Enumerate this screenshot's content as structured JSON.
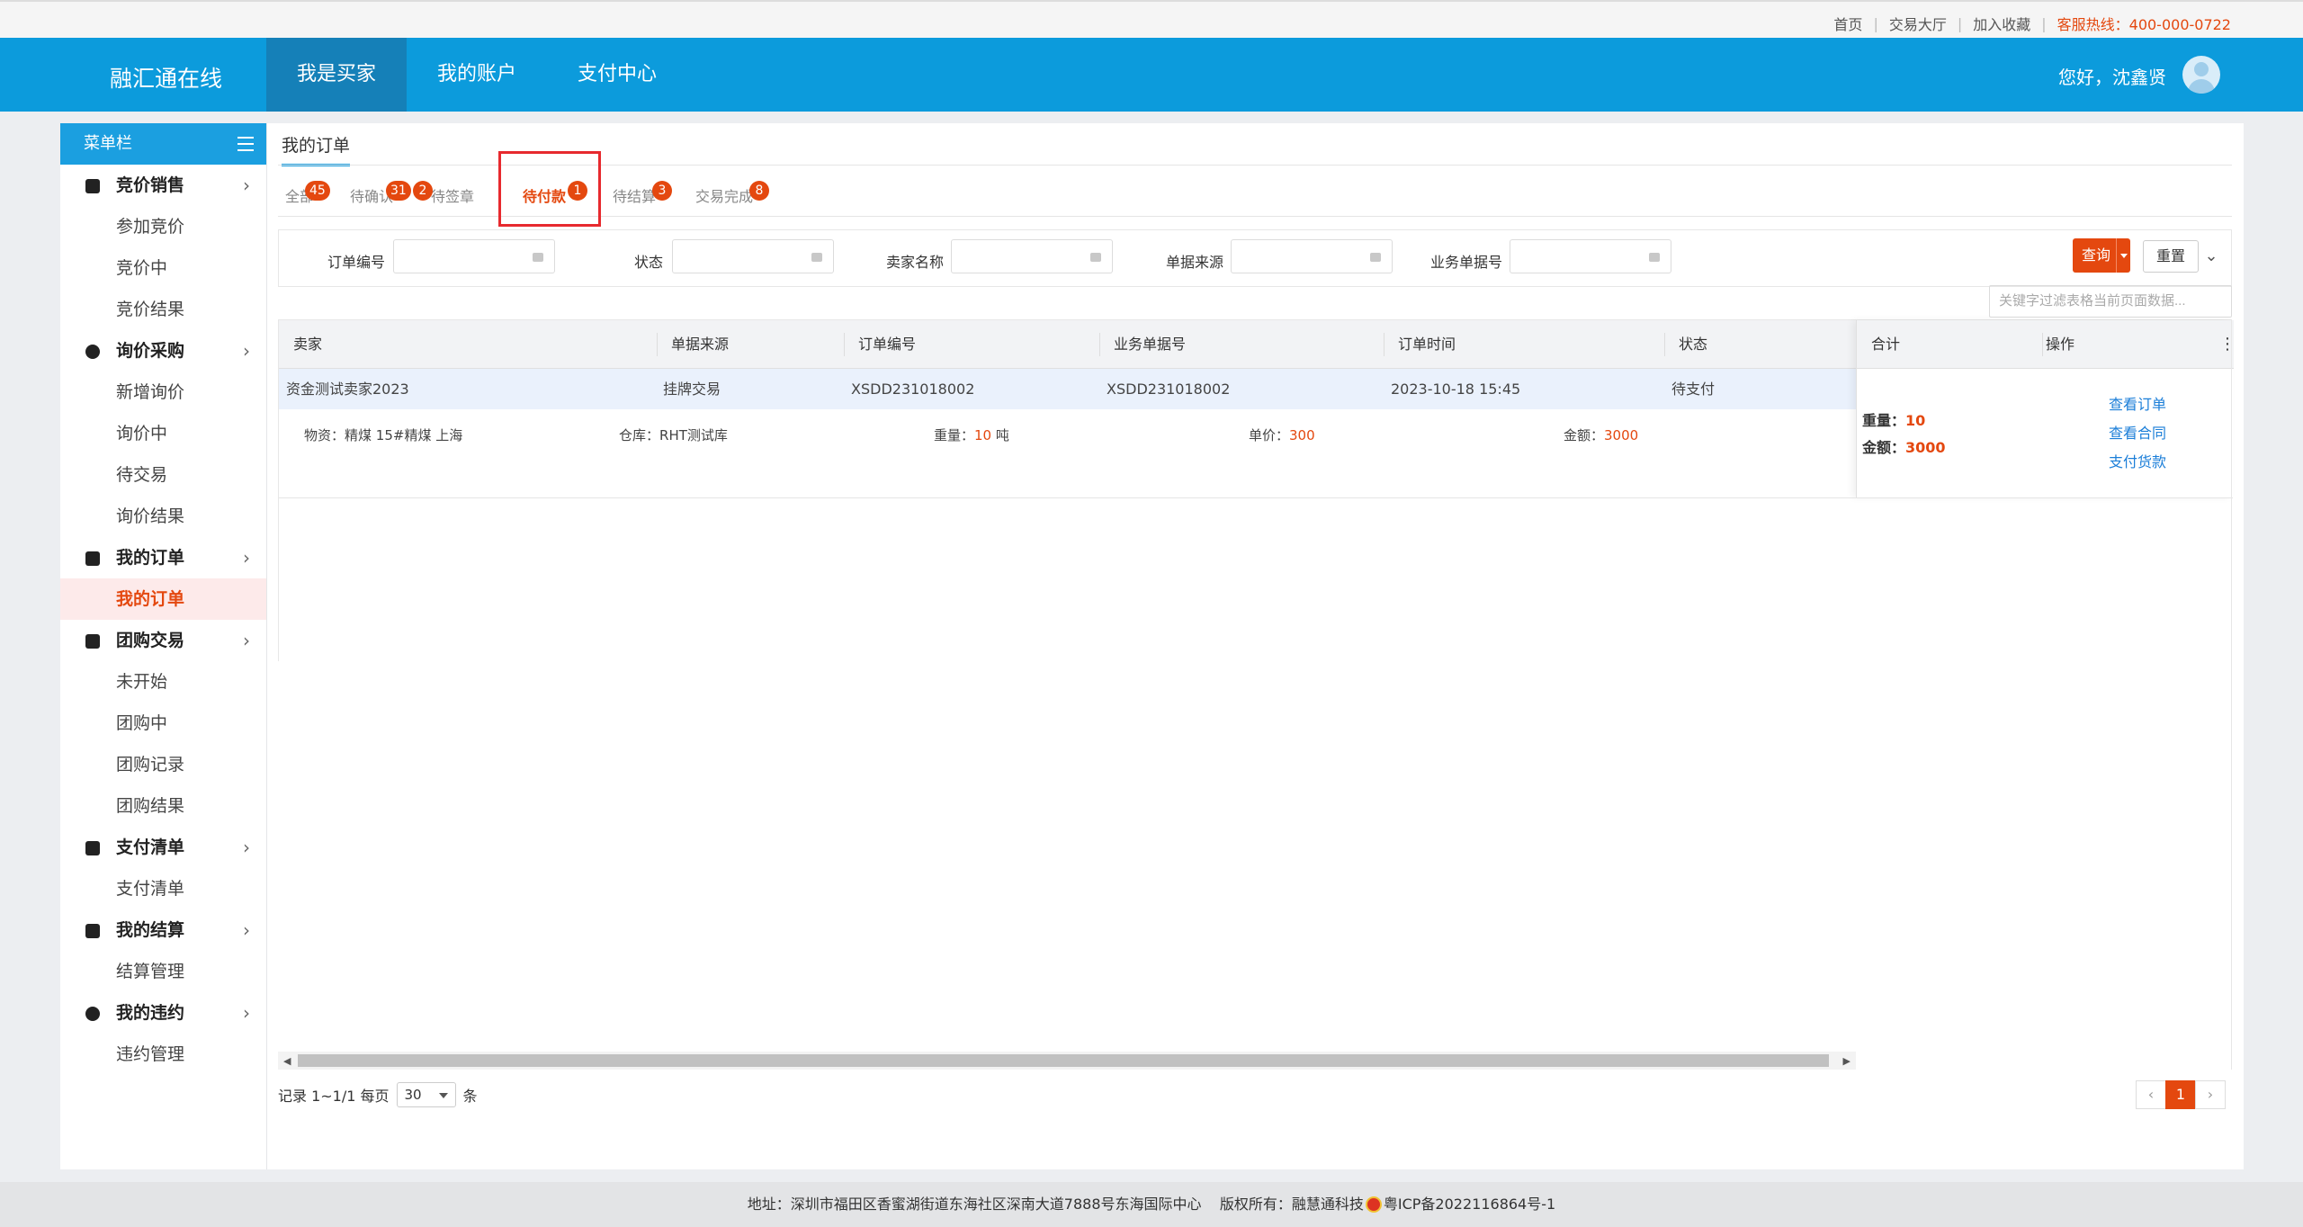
{
  "top_links": {
    "home": "首页",
    "trade_hall": "交易大厅",
    "favorite": "加入收藏",
    "hotline": "客服热线：400-000-0722"
  },
  "header": {
    "logo": "融汇通在线",
    "nav": [
      "我是买家",
      "我的账户",
      "支付中心"
    ],
    "greeting": "您好，沈鑫贤"
  },
  "sidebar": {
    "title": "菜单栏",
    "groups": [
      {
        "label": "竞价销售",
        "icon": "gavel-icon",
        "items": [
          "参加竞价",
          "竞价中",
          "竞价结果"
        ]
      },
      {
        "label": "询价采购",
        "icon": "search-circle-icon",
        "items": [
          "新增询价",
          "询价中",
          "待交易",
          "询价结果"
        ]
      },
      {
        "label": "我的订单",
        "icon": "document-icon",
        "items": [
          "我的订单"
        ]
      },
      {
        "label": "团购交易",
        "icon": "shop-icon",
        "items": [
          "未开始",
          "团购中",
          "团购记录",
          "团购结果"
        ]
      },
      {
        "label": "支付清单",
        "icon": "payment-icon",
        "items": [
          "支付清单"
        ]
      },
      {
        "label": "我的结算",
        "icon": "calculator-icon",
        "items": [
          "结算管理"
        ]
      },
      {
        "label": "我的违约",
        "icon": "alert-icon",
        "items": [
          "违约管理"
        ]
      }
    ]
  },
  "page": {
    "title": "我的订单"
  },
  "tabs": [
    {
      "label": "全部",
      "badge": "45"
    },
    {
      "label": "待确认",
      "badge": "31"
    },
    {
      "label": "待签章",
      "badge": "2"
    },
    {
      "label": "待付款",
      "badge": "1"
    },
    {
      "label": "待结算",
      "badge": "3"
    },
    {
      "label": "交易完成",
      "badge": "8"
    }
  ],
  "filters": {
    "order_no": "订单编号",
    "status": "状态",
    "seller": "卖家名称",
    "source": "单据来源",
    "biz_no": "业务单据号",
    "query": "查询",
    "reset": "重置",
    "search_placeholder": "关键字过滤表格当前页面数据..."
  },
  "table": {
    "headers": [
      "卖家",
      "单据来源",
      "订单编号",
      "业务单据号",
      "订单时间",
      "状态",
      "合计",
      "操作"
    ],
    "row": {
      "seller": "资金测试卖家2023",
      "source": "挂牌交易",
      "order_no": "XSDD231018002",
      "biz_no": "XSDD231018002",
      "time": "2023-10-18 15:45",
      "status": "待支付"
    },
    "detail": {
      "material_label": "物资：",
      "material": "精煤 15#精煤 上海",
      "warehouse_label": "仓库：",
      "warehouse": "RHT测试库",
      "weight_label": "重量：",
      "weight_value": "10",
      "weight_unit": "吨",
      "price_label": "单价：",
      "price": "300",
      "amount_label": "金额：",
      "amount": "3000"
    },
    "summary": {
      "weight_label": "重量：",
      "weight": "10",
      "amount_label": "金额：",
      "amount": "3000"
    },
    "actions": [
      "查看订单",
      "查看合同",
      "支付货款"
    ]
  },
  "pager": {
    "records": "记录 1~1/1 每页",
    "page_size": "30",
    "unit": "条",
    "current": "1"
  },
  "footer": {
    "address": "地址：深圳市福田区香蜜湖街道东海社区深南大道7888号东海国际中心",
    "copyright": "版权所有：融慧通科技",
    "icp": "粤ICP备2022116864号-1"
  }
}
